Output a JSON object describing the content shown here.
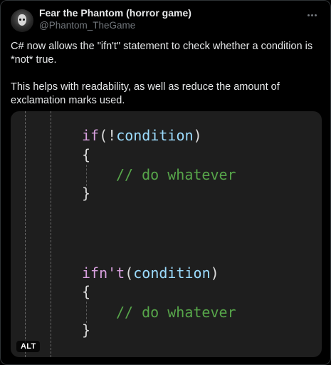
{
  "author": {
    "display_name": "Fear the Phantom (horror game)",
    "handle": "@Phantom_TheGame",
    "avatar_icon": "phantom-mask-avatar"
  },
  "more_icon": "more-horizontal-icon",
  "tweet": {
    "paragraph1": "C# now allows the \"ifn't\" statement to check whether a condition is *not* true.",
    "paragraph2": "This helps with readability, as well as reduce the amount of exclamation marks used."
  },
  "media": {
    "alt_badge": "ALT",
    "code_block_1": {
      "keyword": "if",
      "open_paren": "(",
      "bang": "!",
      "condition": "condition",
      "close_paren": ")",
      "open_brace": "{",
      "comment": "// do whatever",
      "close_brace": "}"
    },
    "code_block_2": {
      "keyword": "ifn't",
      "open_paren": "(",
      "condition": "condition",
      "close_paren": ")",
      "open_brace": "{",
      "comment": "// do whatever",
      "close_brace": "}"
    },
    "colors": {
      "background": "#1e1e1e",
      "keyword": "#d8a0df",
      "variable": "#9cdcfe",
      "comment": "#57a64a",
      "punctuation": "#dcdcdc"
    }
  }
}
